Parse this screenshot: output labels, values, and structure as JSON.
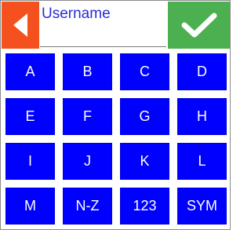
{
  "header": {
    "back_icon": "triangle-left-icon",
    "field_placeholder": "Username",
    "field_value": "",
    "confirm_icon": "checkmark-icon"
  },
  "colors": {
    "back_button": "#f4511e",
    "confirm_button": "#4caf50",
    "key_background": "#0000ff",
    "key_text": "#ffffff",
    "field_text": "#2b2bd6"
  },
  "keys": [
    {
      "label": "A"
    },
    {
      "label": "B"
    },
    {
      "label": "C"
    },
    {
      "label": "D"
    },
    {
      "label": "E"
    },
    {
      "label": "F"
    },
    {
      "label": "G"
    },
    {
      "label": "H"
    },
    {
      "label": "I"
    },
    {
      "label": "J"
    },
    {
      "label": "K"
    },
    {
      "label": "L"
    },
    {
      "label": "M"
    },
    {
      "label": "N-Z"
    },
    {
      "label": "123"
    },
    {
      "label": "SYM"
    }
  ]
}
